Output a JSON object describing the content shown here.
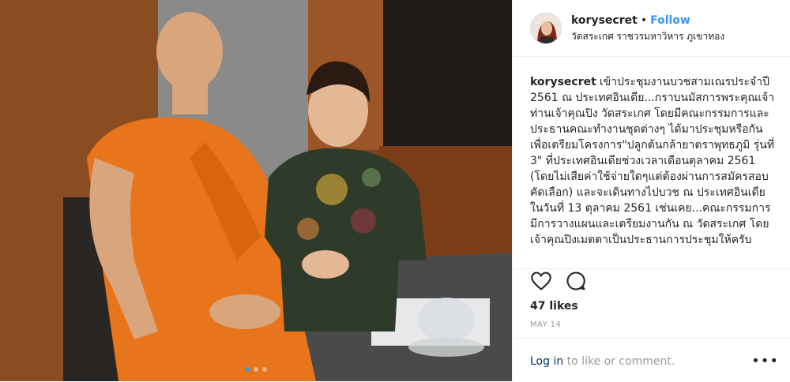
{
  "post": {
    "username": "korysecret",
    "separator": "•",
    "follow_label": "Follow",
    "location": "วัดสระเกศ ราชวรมหาวิหาร ภูเขาทอง",
    "caption_user": "korysecret",
    "caption_text": "เข้าประชุมงานบวชสามเณรประจำปี 2561 ณ ประเทศอินเดีย...กราบนมัสการพระคุณเจ้า ท่านเจ้าคุณปิง วัดสระเกศ โดยมีคณะกรรมการและประธานคณะทำงานชุดต่างๆ ได้มาประชุมหรือกันเพื่อเตรียมโครงการ\"ปลูกต้นกล้ายาตราพุทธภูมิ รุ่นที่ 3\" ที่ประเทศอินเดียช่วงเวลาเดือนตุลาคม 2561 (โดยไม่เสียค่าใช้จ่ายใดๆแต่ต้องผ่านการสมัครสอบคัดเลือก) และจะเดินทางไปบวช ณ ประเทศอินเดียในวันที่ 13 ตุลาคม 2561 เช่นเคย...คณะกรรมการมีการวางแผนและเตรียมงานกัน ณ วัดสระเกศ โดยเจ้าคุณปิงเมตตาเป็นประธานการประชุมให้ครับ",
    "likes": "47 likes",
    "date": "MAY 14",
    "login_link": "Log in",
    "login_rest": " to like or comment.",
    "more_label": "•••"
  },
  "carousel": {
    "count": 3,
    "active": 0
  },
  "icons": {
    "like": "heart-icon",
    "comment": "comment-icon",
    "more": "more-options-icon"
  },
  "colors": {
    "accent": "#3897f0",
    "text": "#262626",
    "muted": "#999999",
    "border": "#efefef",
    "robe": "#e8741c"
  }
}
